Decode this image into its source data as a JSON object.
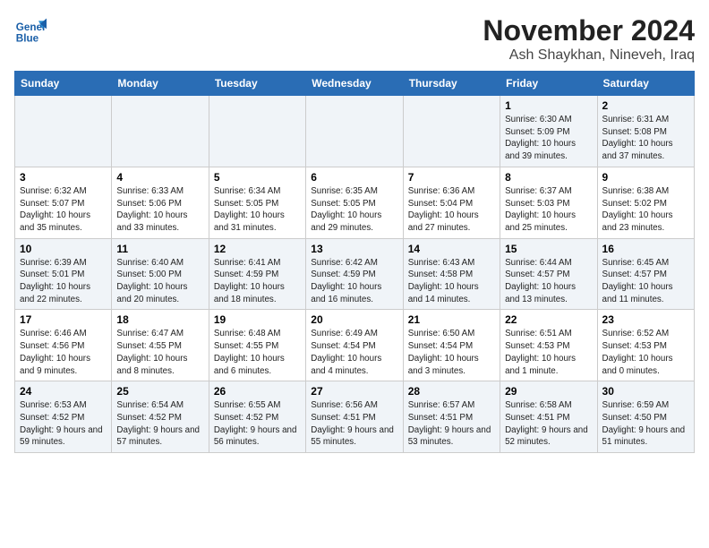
{
  "header": {
    "logo_line1": "General",
    "logo_line2": "Blue",
    "month": "November 2024",
    "location": "Ash Shaykhan, Nineveh, Iraq"
  },
  "weekdays": [
    "Sunday",
    "Monday",
    "Tuesday",
    "Wednesday",
    "Thursday",
    "Friday",
    "Saturday"
  ],
  "weeks": [
    [
      {
        "day": "",
        "info": ""
      },
      {
        "day": "",
        "info": ""
      },
      {
        "day": "",
        "info": ""
      },
      {
        "day": "",
        "info": ""
      },
      {
        "day": "",
        "info": ""
      },
      {
        "day": "1",
        "info": "Sunrise: 6:30 AM\nSunset: 5:09 PM\nDaylight: 10 hours and 39 minutes."
      },
      {
        "day": "2",
        "info": "Sunrise: 6:31 AM\nSunset: 5:08 PM\nDaylight: 10 hours and 37 minutes."
      }
    ],
    [
      {
        "day": "3",
        "info": "Sunrise: 6:32 AM\nSunset: 5:07 PM\nDaylight: 10 hours and 35 minutes."
      },
      {
        "day": "4",
        "info": "Sunrise: 6:33 AM\nSunset: 5:06 PM\nDaylight: 10 hours and 33 minutes."
      },
      {
        "day": "5",
        "info": "Sunrise: 6:34 AM\nSunset: 5:05 PM\nDaylight: 10 hours and 31 minutes."
      },
      {
        "day": "6",
        "info": "Sunrise: 6:35 AM\nSunset: 5:05 PM\nDaylight: 10 hours and 29 minutes."
      },
      {
        "day": "7",
        "info": "Sunrise: 6:36 AM\nSunset: 5:04 PM\nDaylight: 10 hours and 27 minutes."
      },
      {
        "day": "8",
        "info": "Sunrise: 6:37 AM\nSunset: 5:03 PM\nDaylight: 10 hours and 25 minutes."
      },
      {
        "day": "9",
        "info": "Sunrise: 6:38 AM\nSunset: 5:02 PM\nDaylight: 10 hours and 23 minutes."
      }
    ],
    [
      {
        "day": "10",
        "info": "Sunrise: 6:39 AM\nSunset: 5:01 PM\nDaylight: 10 hours and 22 minutes."
      },
      {
        "day": "11",
        "info": "Sunrise: 6:40 AM\nSunset: 5:00 PM\nDaylight: 10 hours and 20 minutes."
      },
      {
        "day": "12",
        "info": "Sunrise: 6:41 AM\nSunset: 4:59 PM\nDaylight: 10 hours and 18 minutes."
      },
      {
        "day": "13",
        "info": "Sunrise: 6:42 AM\nSunset: 4:59 PM\nDaylight: 10 hours and 16 minutes."
      },
      {
        "day": "14",
        "info": "Sunrise: 6:43 AM\nSunset: 4:58 PM\nDaylight: 10 hours and 14 minutes."
      },
      {
        "day": "15",
        "info": "Sunrise: 6:44 AM\nSunset: 4:57 PM\nDaylight: 10 hours and 13 minutes."
      },
      {
        "day": "16",
        "info": "Sunrise: 6:45 AM\nSunset: 4:57 PM\nDaylight: 10 hours and 11 minutes."
      }
    ],
    [
      {
        "day": "17",
        "info": "Sunrise: 6:46 AM\nSunset: 4:56 PM\nDaylight: 10 hours and 9 minutes."
      },
      {
        "day": "18",
        "info": "Sunrise: 6:47 AM\nSunset: 4:55 PM\nDaylight: 10 hours and 8 minutes."
      },
      {
        "day": "19",
        "info": "Sunrise: 6:48 AM\nSunset: 4:55 PM\nDaylight: 10 hours and 6 minutes."
      },
      {
        "day": "20",
        "info": "Sunrise: 6:49 AM\nSunset: 4:54 PM\nDaylight: 10 hours and 4 minutes."
      },
      {
        "day": "21",
        "info": "Sunrise: 6:50 AM\nSunset: 4:54 PM\nDaylight: 10 hours and 3 minutes."
      },
      {
        "day": "22",
        "info": "Sunrise: 6:51 AM\nSunset: 4:53 PM\nDaylight: 10 hours and 1 minute."
      },
      {
        "day": "23",
        "info": "Sunrise: 6:52 AM\nSunset: 4:53 PM\nDaylight: 10 hours and 0 minutes."
      }
    ],
    [
      {
        "day": "24",
        "info": "Sunrise: 6:53 AM\nSunset: 4:52 PM\nDaylight: 9 hours and 59 minutes."
      },
      {
        "day": "25",
        "info": "Sunrise: 6:54 AM\nSunset: 4:52 PM\nDaylight: 9 hours and 57 minutes."
      },
      {
        "day": "26",
        "info": "Sunrise: 6:55 AM\nSunset: 4:52 PM\nDaylight: 9 hours and 56 minutes."
      },
      {
        "day": "27",
        "info": "Sunrise: 6:56 AM\nSunset: 4:51 PM\nDaylight: 9 hours and 55 minutes."
      },
      {
        "day": "28",
        "info": "Sunrise: 6:57 AM\nSunset: 4:51 PM\nDaylight: 9 hours and 53 minutes."
      },
      {
        "day": "29",
        "info": "Sunrise: 6:58 AM\nSunset: 4:51 PM\nDaylight: 9 hours and 52 minutes."
      },
      {
        "day": "30",
        "info": "Sunrise: 6:59 AM\nSunset: 4:50 PM\nDaylight: 9 hours and 51 minutes."
      }
    ]
  ]
}
